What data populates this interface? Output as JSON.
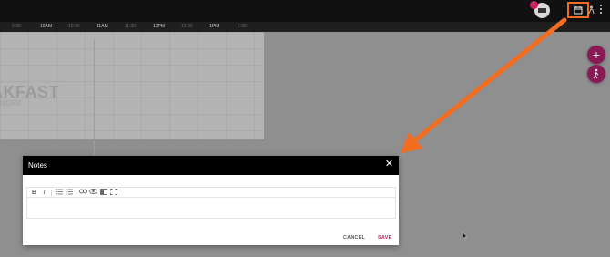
{
  "topbar": {
    "notification_count": "1",
    "calendar_icon": "calendar-icon",
    "menu_icon": "more-vert-icon"
  },
  "timeline": {
    "ticks": [
      {
        "label": "9:30",
        "major": false
      },
      {
        "label": "10AM",
        "major": true
      },
      {
        "label": "10:30",
        "major": false
      },
      {
        "label": "11AM",
        "major": true
      },
      {
        "label": "11:30",
        "major": false
      },
      {
        "label": "12PM",
        "major": true
      },
      {
        "label": "12:30",
        "major": false
      },
      {
        "label": "1PM",
        "major": true
      },
      {
        "label": "1:30",
        "major": false
      }
    ]
  },
  "schedule": {
    "event_title": "AKFAST",
    "event_subtitle": "NGER"
  },
  "fabs": {
    "add_label": "+",
    "walk_icon": "person-walk-icon"
  },
  "modal": {
    "title": "Notes",
    "close_icon": "close-icon",
    "toolbar": {
      "bold": "B",
      "italic": "I",
      "bullet_list_icon": "bullet-list-icon",
      "numbered_list_icon": "numbered-list-icon",
      "link_icon": "link-icon",
      "preview_icon": "eye-icon",
      "side_by_side_icon": "columns-icon",
      "fullscreen_icon": "fullscreen-icon"
    },
    "body_value": "",
    "cancel_label": "CANCEL",
    "save_label": "SAVE"
  },
  "colors": {
    "accent": "#d81b60",
    "annotation": "#f36d21",
    "fab": "#8a1a54"
  }
}
